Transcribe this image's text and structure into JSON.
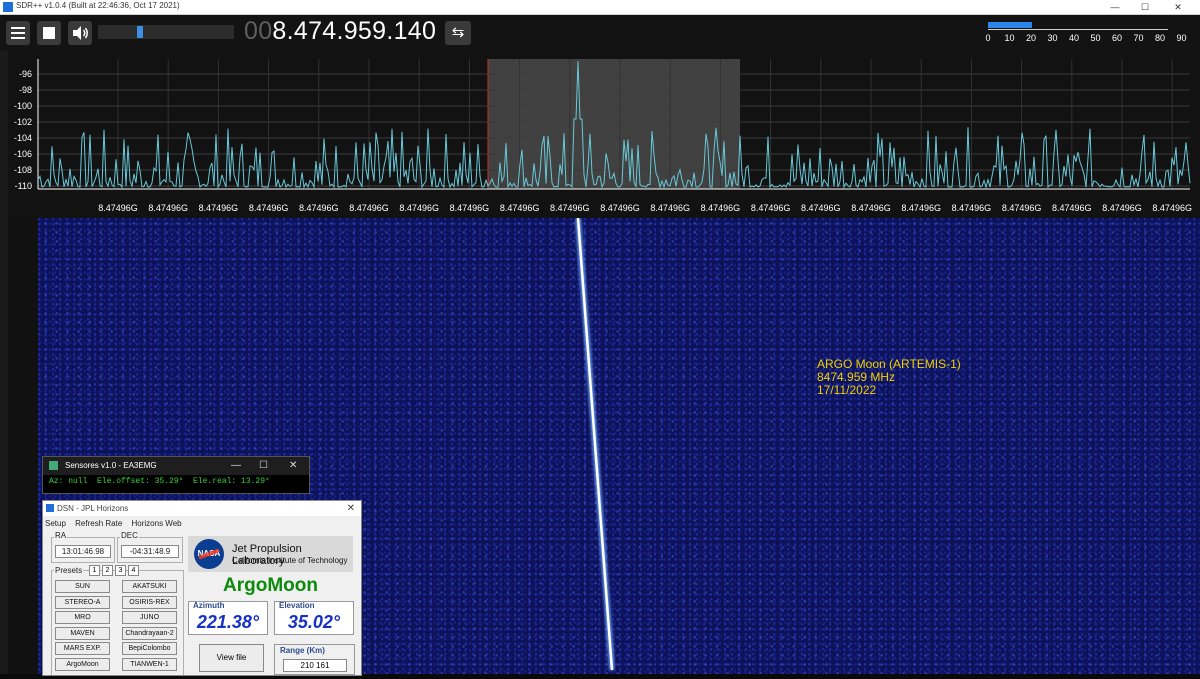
{
  "window": {
    "title": "SDR++ v1.0.4 (Built at 22:46:36, Oct 17 2021)",
    "min": "—",
    "max": "☐",
    "close": "✕"
  },
  "toolbar": {
    "freq_dim": "00",
    "freq_main": "8.474.959.140",
    "swap_symbol": "⇆",
    "volume_level_fraction": 0.3,
    "scale_ticks": [
      "0",
      "10",
      "20",
      "30",
      "40",
      "50",
      "60",
      "70",
      "80",
      "90"
    ]
  },
  "fft": {
    "y_labels": [
      "-96",
      "-98",
      "-100",
      "-102",
      "-104",
      "-106",
      "-108",
      "-110"
    ],
    "x_labels": [
      "8.47496G",
      "8.47496G",
      "8.47496G",
      "8.47496G",
      "8.47496G",
      "8.47496G",
      "8.47496G",
      "8.47496G",
      "8.47496G",
      "8.47496G",
      "8.47496G",
      "8.47496G",
      "8.47496G",
      "8.47496G",
      "8.47496G",
      "8.47496G",
      "8.47496G",
      "8.47496G",
      "8.47496G",
      "8.47496G",
      "8.47496G",
      "8.47496G",
      "8.47496G"
    ],
    "trace_color": "#69c8d8"
  },
  "annotation": {
    "line1": "ARGO Moon (ARTEMIS-1)",
    "line2": "8474.959 MHz",
    "line3": "17/11/2022",
    "color": "#f0d000"
  },
  "sensores": {
    "title": "Sensores v1.0 - EA3EMG",
    "min": "—",
    "max": "☐",
    "close": "✕",
    "readout": "Az: null  Ele.offset: 35.29°  Ele.real: 13.29°"
  },
  "dsn": {
    "title": "DSN - JPL Horizons",
    "close": "✕",
    "menu": [
      "Setup",
      "Refresh Rate",
      "Horizons Web"
    ],
    "ra_label": "RA",
    "ra_value": "13:01:46.98",
    "dec_label": "DEC",
    "dec_value": "-04:31:48.9",
    "presets_label": "Presets",
    "preset_tabs": [
      "1",
      "2",
      "3",
      "4"
    ],
    "presets_left": [
      "SUN",
      "STEREO-A",
      "MRO",
      "MAVEN",
      "MARS EXP.",
      "ArgoMoon"
    ],
    "presets_right": [
      "AKATSUKI",
      "OSIRIS-REX",
      "JUNO",
      "Chandrayaan-2",
      "BepiColombo",
      "TIANWEN-1"
    ],
    "nasa_logo": "NASA",
    "jpl_title": "Jet Propulsion Laboratory",
    "jpl_sub": "California Institute of Technology",
    "spacecraft": "ArgoMoon",
    "azimuth_label": "Azimuth",
    "azimuth_value": "221.38°",
    "elevation_label": "Elevation",
    "elevation_value": "35.02°",
    "view_button": "View file",
    "range_label": "Range (Km)",
    "range_value": "210 161"
  }
}
